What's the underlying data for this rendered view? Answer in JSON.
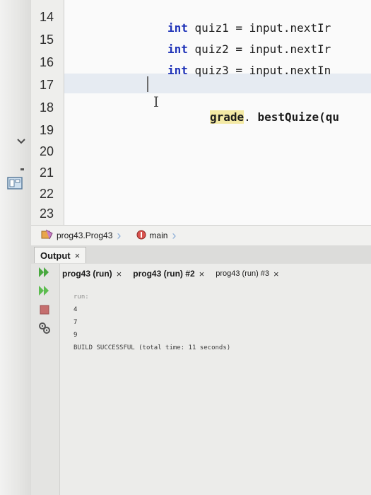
{
  "gutter": {
    "line_numbers": [
      "14",
      "15",
      "16",
      "17",
      "18",
      "19",
      "20",
      "21",
      "22",
      "23"
    ]
  },
  "editor": {
    "lines": [
      {
        "keyword": "int",
        "var": "quiz1",
        "op": "=",
        "obj": "input",
        "method": ".nextIr"
      },
      {
        "keyword": "int",
        "var": "quiz2",
        "op": "=",
        "obj": "input",
        "method": ".nextIr"
      },
      {
        "keyword": "int",
        "var": "quiz3",
        "op": "=",
        "obj": "input",
        "method": ".nextIn"
      }
    ],
    "call_line": {
      "field": "grade",
      "dot": ".",
      "method": " bestQuize(qu"
    }
  },
  "breadcrumb": {
    "class_label": "prog43.Prog43",
    "method_label": "main"
  },
  "output": {
    "tab_label": "Output",
    "close_glyph": "×",
    "run_tabs": [
      {
        "label": "prog43 (run)",
        "close": "×"
      },
      {
        "label": "prog43 (run) #2",
        "close": "×"
      },
      {
        "label": "prog43 (run) #3",
        "close": "×"
      }
    ],
    "lines": [
      "run:",
      "4",
      "7",
      "9",
      "BUILD SUCCESSFUL (total time: 11 seconds)"
    ]
  },
  "colors": {
    "keyword": "#1f33b8",
    "run_green": "#3aa33a",
    "stop_red": "#c56e6e"
  },
  "icons": {
    "collapse": "chevron-down-icon",
    "panel": "panel-icon",
    "run": "run-icon",
    "rerun": "rerun-icon",
    "stop": "stop-icon",
    "settings": "gear-icon"
  }
}
